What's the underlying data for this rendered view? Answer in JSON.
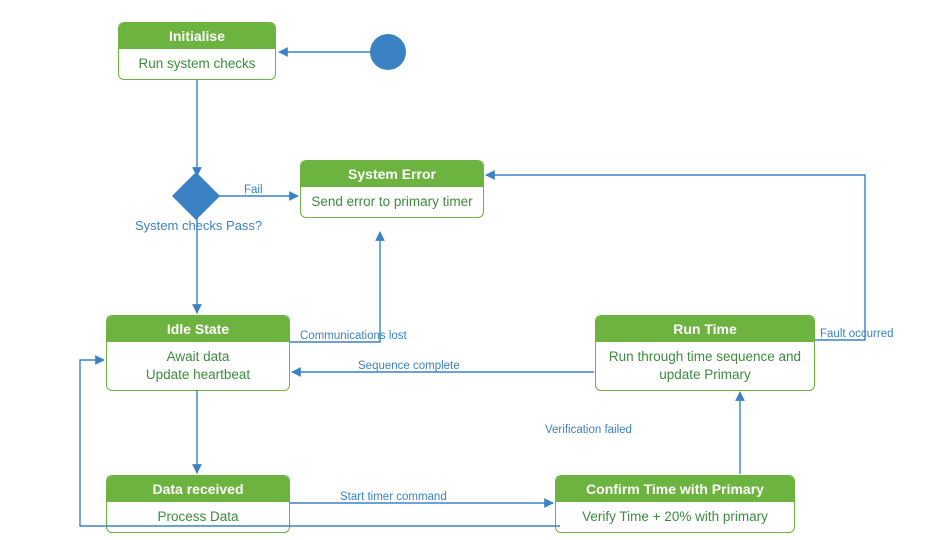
{
  "colors": {
    "green": "#6db33f",
    "greenText": "#3d8b3d",
    "blue": "#3b82c4"
  },
  "nodes": {
    "initialise": {
      "title": "Initialise",
      "body": "Run system checks"
    },
    "system_error": {
      "title": "System Error",
      "body": "Send error to primary timer"
    },
    "idle": {
      "title": "Idle State",
      "body": "Await data\nUpdate heartbeat"
    },
    "runtime": {
      "title": "Run Time",
      "body": "Run through time sequence and update Primary"
    },
    "data_received": {
      "title": "Data received",
      "body": "Process Data"
    },
    "confirm": {
      "title": "Confirm Time with Primary",
      "body": "Verify Time + 20% with primary"
    }
  },
  "decision": {
    "label": "System checks Pass?"
  },
  "edge_labels": {
    "fail": "Fail",
    "comm_lost": "Communications lost",
    "seq_complete": "Sequence complete",
    "start_timer": "Start timer command",
    "verify_failed": "Verification failed",
    "fault": "Fault occurred"
  }
}
